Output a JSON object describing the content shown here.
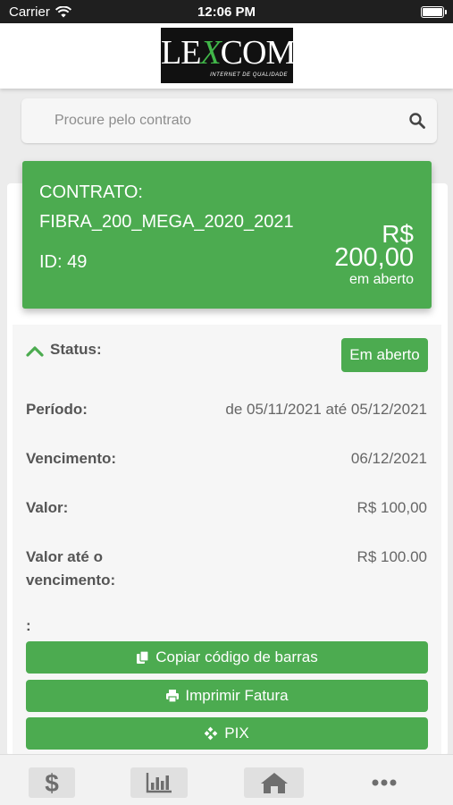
{
  "status_bar": {
    "carrier": "Carrier",
    "time": "12:06 PM"
  },
  "header": {
    "logo": {
      "brand_left": "LE",
      "brand_x": "X",
      "brand_right": "COM",
      "tagline": "INTERNET DE QUALIDADE"
    }
  },
  "search": {
    "placeholder": "Procure pelo contrato",
    "value": ""
  },
  "contract": {
    "label": "CONTRATO:",
    "name": "FIBRA_200_MEGA_2020_2021",
    "id": "ID: 49",
    "currency": "R$",
    "amount": "200,00",
    "amount_status": "em aberto"
  },
  "details": {
    "status_label": "Status:",
    "status_value": "Em aberto",
    "periodo_label": "Período:",
    "periodo_value": "de 05/11/2021 até 05/12/2021",
    "vencimento_label": "Vencimento:",
    "vencimento_value": "06/12/2021",
    "valor_label": "Valor:",
    "valor_value": "R$ 100,00",
    "valor_ate_label_line1": "Valor até o",
    "valor_ate_label_line2": "vencimento:",
    "valor_ate_value": "R$ 100.00",
    "extra_label": ":"
  },
  "actions": {
    "copy_barcode": "Copiar código de barras",
    "print_invoice": "Imprimir Fatura",
    "pix": "PIX"
  },
  "tabs": [
    {
      "icon": "dollar-icon"
    },
    {
      "icon": "bar-chart-icon"
    },
    {
      "icon": "home-icon"
    },
    {
      "icon": "more-icon"
    }
  ],
  "colors": {
    "accent": "#4cab50",
    "logo_bg": "#111111",
    "logo_x": "#41b649"
  }
}
